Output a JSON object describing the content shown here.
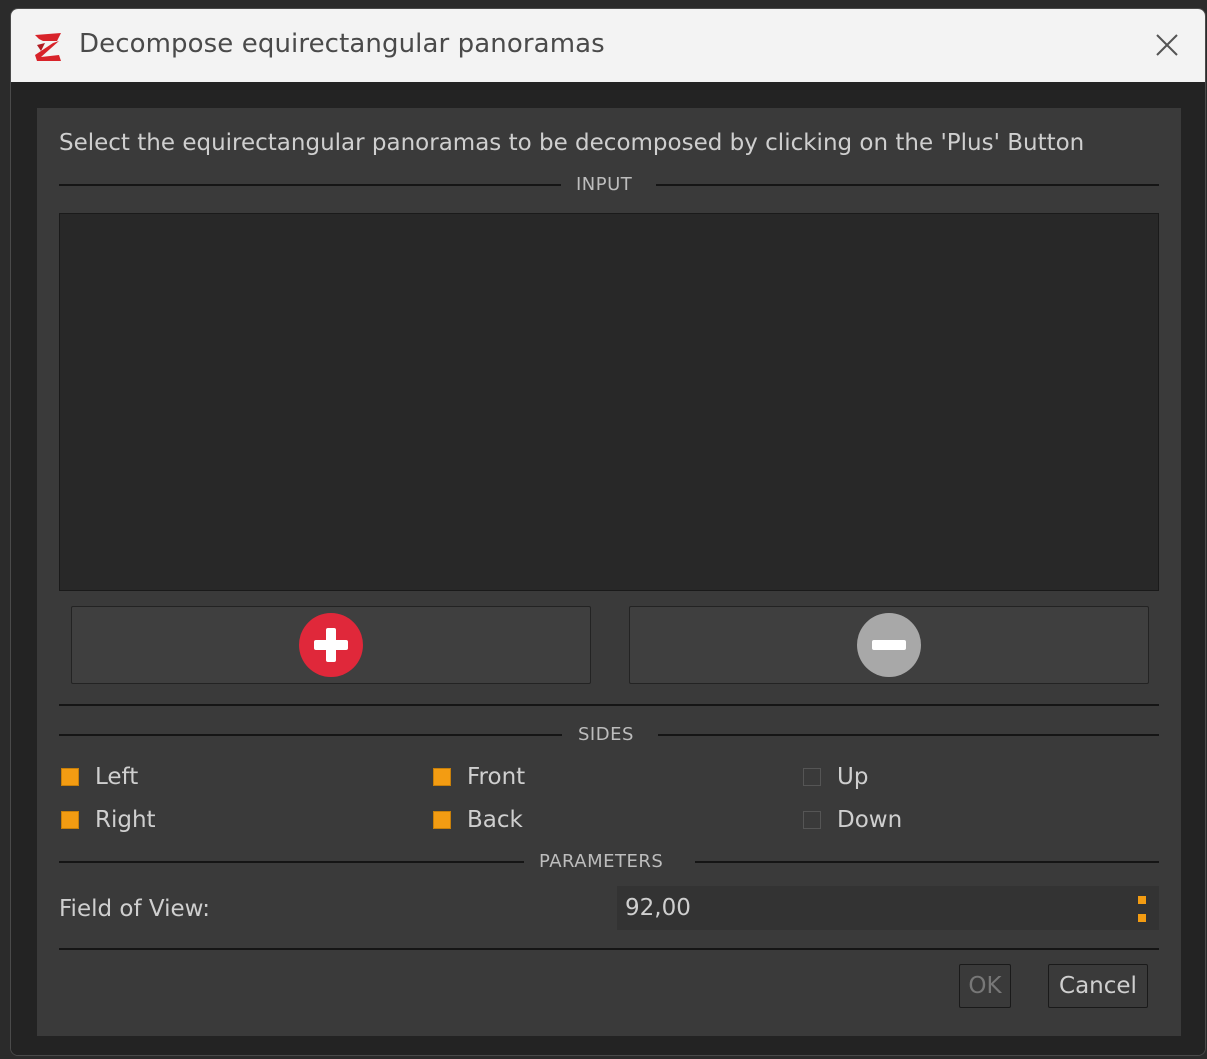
{
  "window": {
    "title": "Decompose equirectangular panoramas",
    "app_icon": "3df-zephyr-logo-icon",
    "close_icon": "close-icon"
  },
  "instruction_text": "Select the equirectangular panoramas to be decomposed by clicking on the 'Plus' Button",
  "sections": {
    "input": "INPUT",
    "sides": "SIDES",
    "parameters": "PARAMETERS"
  },
  "input_list": {
    "items": []
  },
  "buttons": {
    "add_icon": "plus-circle-icon",
    "remove_icon": "minus-circle-icon",
    "ok_label": "OK",
    "cancel_label": "Cancel"
  },
  "sides": {
    "left": {
      "label": "Left",
      "checked": true
    },
    "front": {
      "label": "Front",
      "checked": true
    },
    "up": {
      "label": "Up",
      "checked": false
    },
    "right": {
      "label": "Right",
      "checked": true
    },
    "back": {
      "label": "Back",
      "checked": true
    },
    "down": {
      "label": "Down",
      "checked": false
    }
  },
  "parameters": {
    "fov_label": "Field of View:",
    "fov_value": "92,00"
  },
  "colors": {
    "accent": "#f39c12",
    "add_red": "#e0283a",
    "remove_gray": "#a8a8a8",
    "panel_bg": "#3a3a3a",
    "list_bg": "#282828"
  }
}
